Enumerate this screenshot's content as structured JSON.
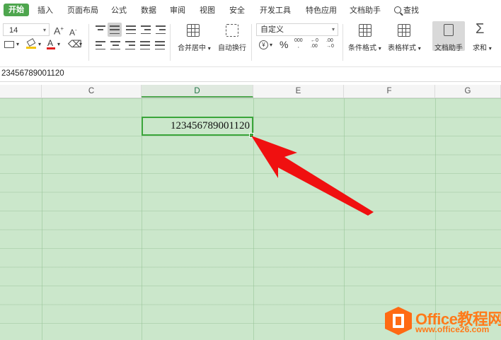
{
  "menu": {
    "items": [
      "开始",
      "插入",
      "页面布局",
      "公式",
      "数据",
      "审阅",
      "视图",
      "安全",
      "开发工具",
      "特色应用",
      "文档助手"
    ],
    "search_label": "查找"
  },
  "ribbon": {
    "font_size": "14",
    "number_format": "自定义",
    "merge_label": "合并居中",
    "wrap_label": "自动换行",
    "percent_symbol": "%",
    "thousands_symbol": "000",
    "dec_increase": ".00",
    "dec_decrease": ".00",
    "cond_format_label": "条件格式",
    "table_style_label": "表格样式",
    "doc_helper_label": "文档助手",
    "sum_label": "求和",
    "font_grow": "A",
    "font_shrink": "A",
    "font_color_letter": "A",
    "accent_color": "#4ea64e"
  },
  "formula_bar": {
    "value": "23456789001120"
  },
  "sheet": {
    "columns": [
      "C",
      "D",
      "E",
      "F",
      "G"
    ],
    "selected_column": "D",
    "active_cell_value": "123456789001120",
    "grid_color": "#cbe7cb"
  },
  "annotation": {
    "arrow_color": "#f01010"
  },
  "watermark": {
    "title": "Office教程网",
    "url": "www.office26.com",
    "color": "#ff7a1a"
  }
}
